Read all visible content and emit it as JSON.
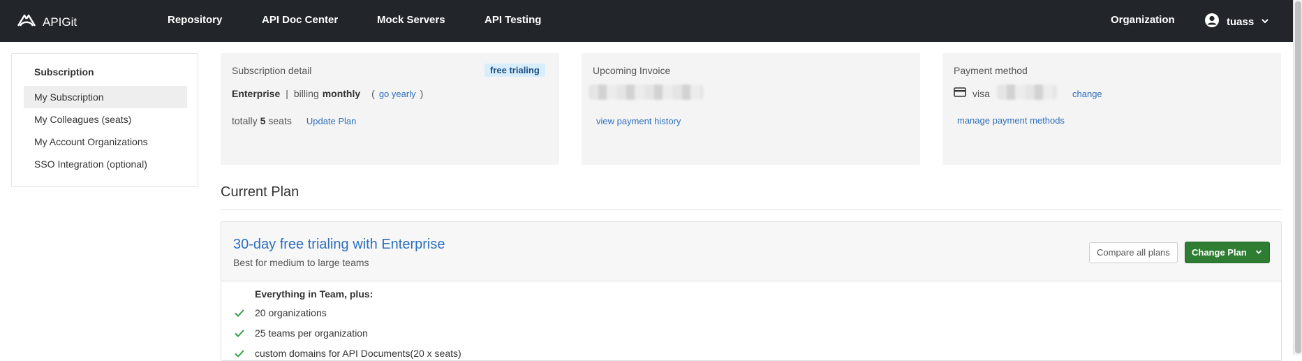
{
  "header": {
    "logo_text": "APIGit",
    "nav": [
      "Repository",
      "API Doc Center",
      "Mock Servers",
      "API Testing"
    ],
    "organization": "Organization",
    "user": "tuass"
  },
  "sidebar": {
    "title": "Subscription",
    "items": [
      {
        "label": "My Subscription",
        "active": true
      },
      {
        "label": "My Colleagues (seats)"
      },
      {
        "label": "My Account Organizations"
      },
      {
        "label": "SSO Integration (optional)"
      }
    ]
  },
  "subscription_detail": {
    "title": "Subscription detail",
    "badge": "free trialing",
    "plan": "Enterprise",
    "separator": "|",
    "billing_label": "billing",
    "billing_value": "monthly",
    "paren_open": "(",
    "go_yearly": "go yearly",
    "paren_close": ")",
    "totally_label": "totally",
    "seats_count": "5",
    "seats_label": "seats",
    "update_plan": "Update Plan"
  },
  "upcoming_invoice": {
    "title": "Upcoming Invoice",
    "payment_history": "view payment history"
  },
  "payment_method": {
    "title": "Payment method",
    "card_brand": "visa",
    "change": "change",
    "manage": "manage payment methods"
  },
  "current_plan": {
    "section_title": "Current Plan",
    "name": "30-day free trialing with Enterprise",
    "subtitle": "Best for medium to large teams",
    "compare_button": "Compare all plans",
    "change_button": "Change Plan",
    "features_heading": "Everything in Team, plus:",
    "features": [
      "20 organizations",
      "25 teams per organization",
      "custom domains for API Documents(20 x seats)"
    ]
  },
  "colors": {
    "topbar": "#22262b",
    "link": "#2e6fbf",
    "primary_button": "#2e7d32",
    "badge_bg": "#d9eefc",
    "check": "#2e9e44"
  }
}
